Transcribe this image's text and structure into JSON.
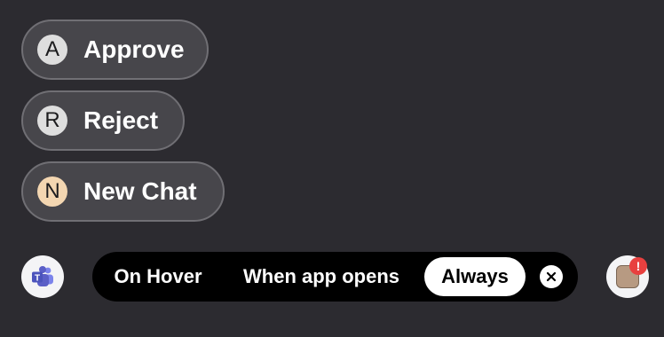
{
  "actions": [
    {
      "badge": "A",
      "label": "Approve"
    },
    {
      "badge": "R",
      "label": "Reject"
    },
    {
      "badge": "N",
      "label": "New Chat"
    }
  ],
  "app_icon": {
    "icon": "teams-icon"
  },
  "visibility_selector": {
    "options": [
      "On Hover",
      "When app opens",
      "Always"
    ],
    "selected": "Always",
    "close_icon": "close-icon"
  },
  "avatar": {
    "notification_badge": "!"
  },
  "colors": {
    "background": "#2c2b30",
    "button_fill": "#47464b",
    "button_border": "#706f74",
    "segmented_bg": "#000000",
    "selected_segment": "#ffffff",
    "notification": "#e8403f",
    "new_chat_badge": "#f3d6b1"
  }
}
